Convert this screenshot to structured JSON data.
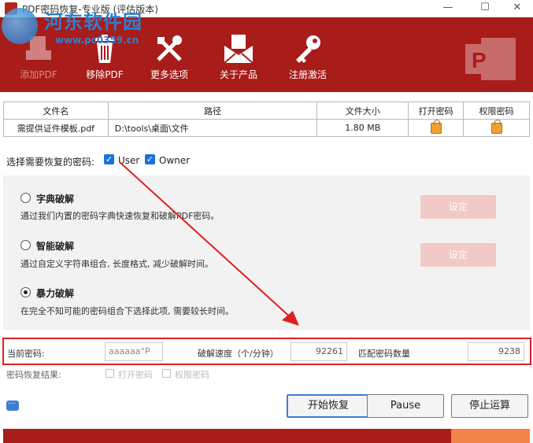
{
  "window": {
    "title": "PDF密码恢复-专业版 (评估版本)",
    "minimize_glyph": "—",
    "maximize_glyph": "☐",
    "close_glyph": "✕"
  },
  "watermark": {
    "text": "河东软件园",
    "url": "www.pc0359.cn"
  },
  "toolbar": {
    "items": [
      {
        "label": "添加PDF",
        "icon": "add-pdf-icon",
        "enabled": false
      },
      {
        "label": "移除PDF",
        "icon": "trash-icon",
        "enabled": true
      },
      {
        "label": "更多选项",
        "icon": "tools-icon",
        "enabled": true
      },
      {
        "label": "关于产品",
        "icon": "envelope-icon",
        "enabled": true
      },
      {
        "label": "注册激活",
        "icon": "key-icon",
        "enabled": true
      }
    ],
    "brand_icon": "powerpoint-pdf-logo"
  },
  "file_table": {
    "columns": [
      "文件名",
      "路径",
      "文件大小",
      "打开密码",
      "权限密码"
    ],
    "rows": [
      {
        "name": "需提供证件模板.pdf",
        "path": "D:\\tools\\桌面\\文件",
        "size": "1.80 MB",
        "open_pwd": "lock-icon",
        "perm_pwd": "lock-icon"
      }
    ]
  },
  "password_select": {
    "label": "选择需要恢复的密码:",
    "options": [
      {
        "label": "User",
        "checked": true
      },
      {
        "label": "Owner",
        "checked": true
      }
    ]
  },
  "attack_options": [
    {
      "title": "字典破解",
      "desc": "通过我们内置的密码字典快速恢复和破解PDF密码。",
      "selected": false,
      "button": "设定"
    },
    {
      "title": "智能破解",
      "desc": "通过自定义字符串组合, 长度格式, 减少破解时间。",
      "selected": false,
      "button": "设定"
    },
    {
      "title": "暴力破解",
      "desc": "在完全不知可能的密码组合下选择此项, 需要较长时间。",
      "selected": true,
      "button": ""
    }
  ],
  "status": {
    "current_password_label": "当前密码:",
    "current_password_value": "aaaaaa°P",
    "speed_label": "破解速度（个/分钟）",
    "speed_value": "92261",
    "matched_label": "匹配密码数量",
    "matched_value": "9238"
  },
  "result": {
    "label": "密码恢复结果:",
    "open_label": "打开密码",
    "perm_label": "权限密码"
  },
  "actions": {
    "start": "开始恢复",
    "pause": "Pause",
    "stop": "停止运算"
  },
  "progress": {
    "fraction": 0.85
  },
  "colors": {
    "brand": "#a81c1a",
    "progress_rest": "#f2834a",
    "annotation": "#e02020",
    "checkbox": "#1a73d9"
  }
}
